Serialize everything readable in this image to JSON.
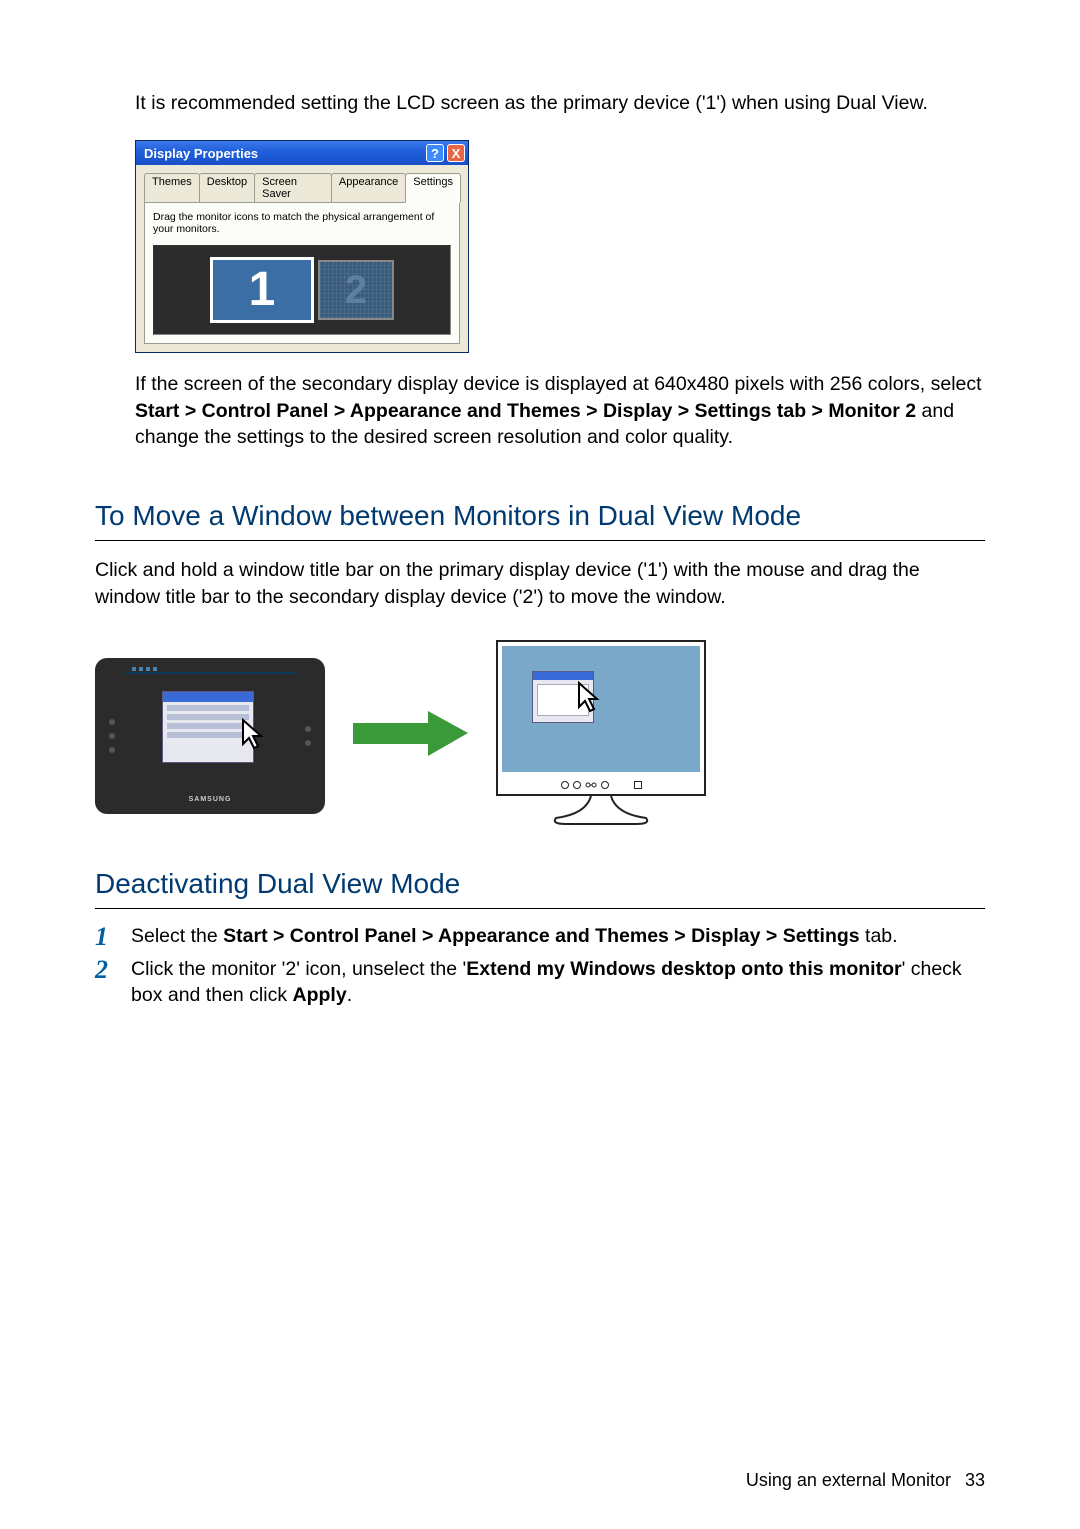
{
  "intro": "It is recommended setting the LCD screen as the primary device ('1') when using Dual View.",
  "dp": {
    "title": "Display Properties",
    "tabs": [
      "Themes",
      "Desktop",
      "Screen Saver",
      "Appearance",
      "Settings"
    ],
    "active_tab_index": 4,
    "instr": "Drag the monitor icons to match the physical arrangement of your monitors.",
    "mon1": "1",
    "mon2": "2"
  },
  "para2_a": "If the screen of the secondary display device is displayed at 640x480 pixels with 256 colors, select ",
  "para2_path": "Start > Control Panel > Appearance and Themes > Display > Settings tab > Monitor 2",
  "para2_b": " and change the settings to the desired screen resolution and color quality.",
  "h2_move": "To Move a Window between Monitors in Dual View Mode",
  "move_para": "Click and hold a window title bar on the primary display device ('1') with the mouse and drag the window title bar to the secondary display device ('2') to move the window.",
  "device_brand": "SAMSUNG",
  "h2_deact": "Deactivating Dual View Mode",
  "steps": {
    "s1_a": "Select the ",
    "s1_path": "Start > Control Panel > Appearance and Themes > Display > Settings",
    "s1_b": " tab.",
    "s2_a": "Click the monitor '2' icon, unselect the '",
    "s2_bold1": "Extend my Windows desktop onto this monitor",
    "s2_b": "' check box and then click ",
    "s2_bold2": "Apply",
    "s2_c": "."
  },
  "footer_text": "Using an external Monitor",
  "footer_page": "33"
}
